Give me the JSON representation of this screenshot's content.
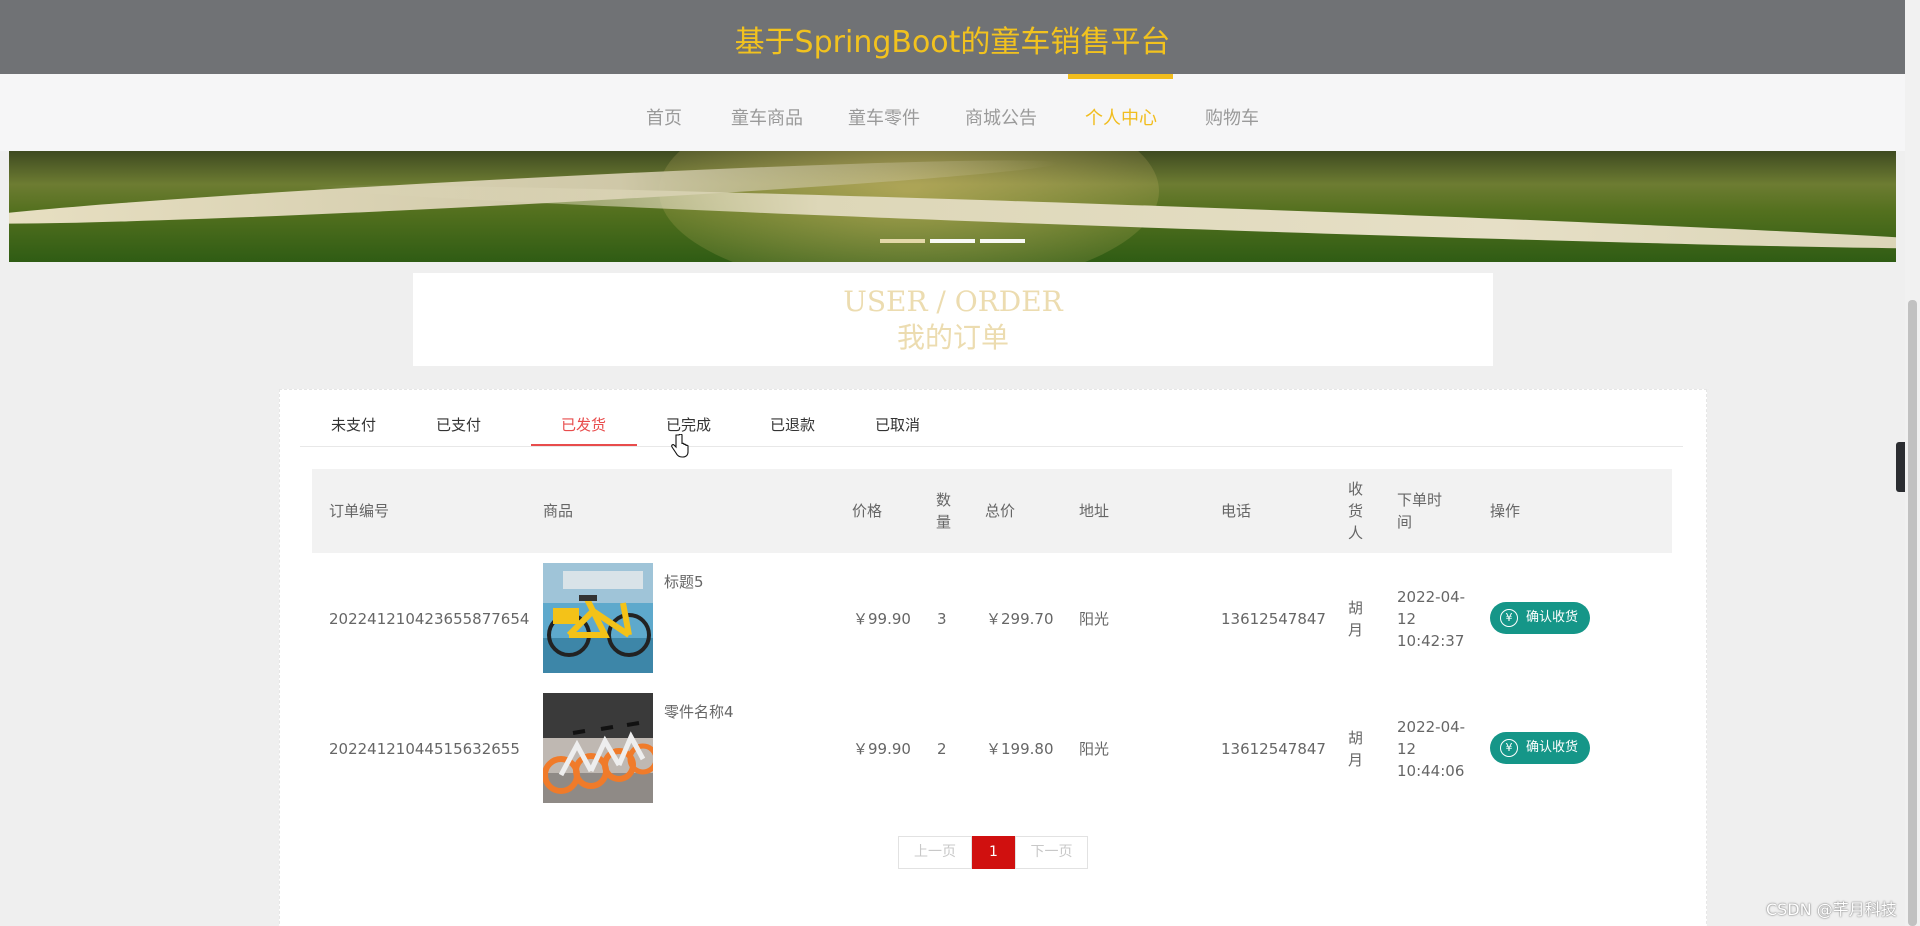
{
  "header": {
    "title": "基于SpringBoot的童车销售平台"
  },
  "nav": {
    "items": [
      {
        "label": "首页"
      },
      {
        "label": "童车商品"
      },
      {
        "label": "童车零件"
      },
      {
        "label": "商城公告"
      },
      {
        "label": "个人中心",
        "active": true
      },
      {
        "label": "购物车"
      }
    ]
  },
  "heading": {
    "en": "USER / ORDER",
    "cn": "我的订单"
  },
  "tabs": [
    {
      "label": "未支付"
    },
    {
      "label": "已支付"
    },
    {
      "label": "已发货",
      "active": true
    },
    {
      "label": "已完成"
    },
    {
      "label": "已退款"
    },
    {
      "label": "已取消"
    }
  ],
  "table": {
    "headers": {
      "order_no": "订单编号",
      "product": "商品",
      "price": "价格",
      "qty": "数量",
      "total": "总价",
      "address": "地址",
      "phone": "电话",
      "receiver": "收货人",
      "time": "下单时间",
      "action": "操作"
    },
    "rows": [
      {
        "order_no": "202241210423655877654",
        "product_name": "标题5",
        "image": "yellow-bike-image",
        "price": "￥99.90",
        "qty": "3",
        "total": "￥299.70",
        "address": "阳光",
        "phone": "13612547847",
        "receiver": "胡月",
        "time_date": "2022-04-12",
        "time_clock": "10:42:37",
        "action_label": "确认收货"
      },
      {
        "order_no": "20224121044515632655",
        "product_name": "零件名称4",
        "image": "orange-bikes-image",
        "price": "￥99.90",
        "qty": "2",
        "total": "￥199.80",
        "address": "阳光",
        "phone": "13612547847",
        "receiver": "胡月",
        "time_date": "2022-04-12",
        "time_clock": "10:44:06",
        "action_label": "确认收货"
      }
    ]
  },
  "pagination": {
    "prev": "上一页",
    "current": "1",
    "next": "下一页"
  },
  "watermark": "CSDN @芊月科技",
  "colors": {
    "accent": "#f1bd1e",
    "tab_active": "#e84c4c",
    "button": "#159688",
    "page_current": "#d0100f"
  }
}
